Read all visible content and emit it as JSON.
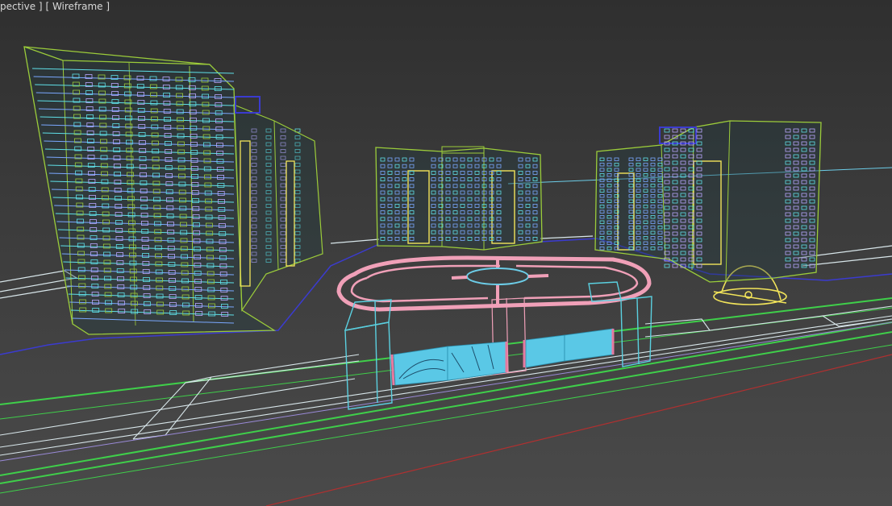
{
  "viewport": {
    "label_view": "[ Perspective ]",
    "label_mode": "[ Wireframe ]",
    "label_view_visible": "pective ]",
    "colors": {
      "background": "#3a3a3a",
      "tower_outline": "#9ccc3a",
      "window_cyan": "#5fe0e8",
      "window_blue": "#7aa8ff",
      "window_violet": "#b9a7ff",
      "plaza": "#f0a0b8",
      "road_green": "#3fcf4a",
      "road_white": "#d8e6ea",
      "site_boundary": "#3b3bd0",
      "dome": "#f2e45a",
      "camera_line": "#6ccde8",
      "axis_red": "#b03030",
      "gate_cyan": "#5ad0e0",
      "gate_panel": "#5ac8e6"
    }
  }
}
